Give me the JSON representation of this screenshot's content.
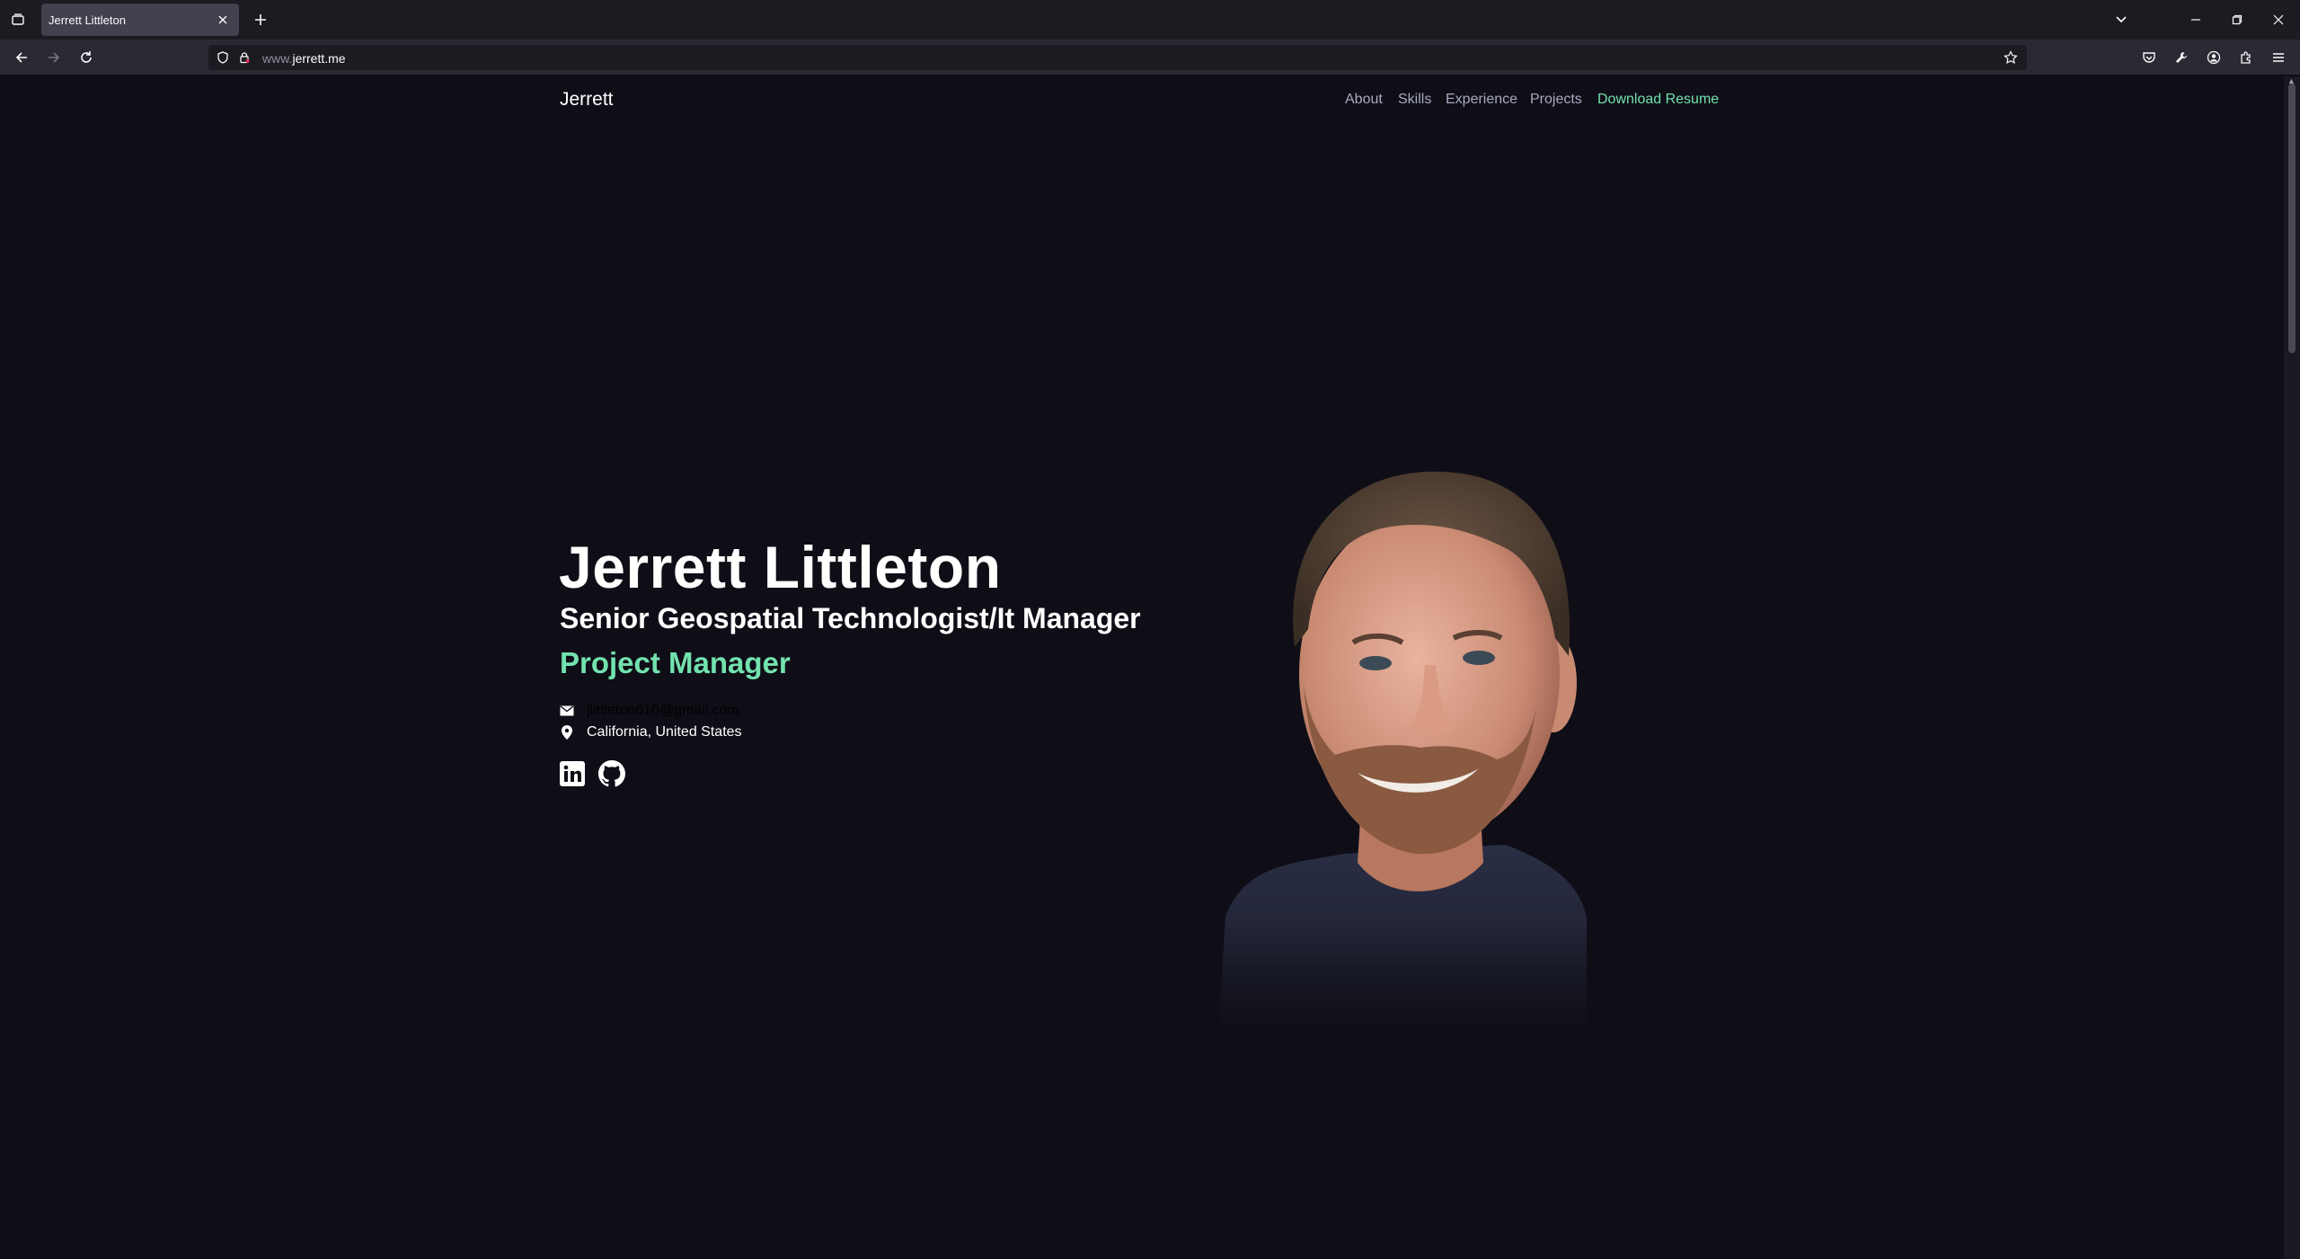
{
  "browser": {
    "tab_title": "Jerrett Littleton",
    "url_prefix": "www.",
    "url_domain": "jerrett.me"
  },
  "site": {
    "brand": "Jerrett",
    "nav": [
      {
        "label": "About"
      },
      {
        "label": "Skills"
      },
      {
        "label": "Experience"
      },
      {
        "label": "Projects"
      },
      {
        "label": "Download Resume"
      }
    ]
  },
  "hero": {
    "name": "Jerrett Littleton",
    "title": "Senior Geospatial Technologist/It Manager",
    "subtitle": "Project Manager",
    "email": "jlittleton610@gmail.com",
    "location": "California, United States"
  },
  "colors": {
    "background": "#0f0e17",
    "text": "#fffffe",
    "muted": "#a7a9be",
    "accent": "#72e2ae"
  },
  "icons": [
    "tab-list-icon",
    "close-icon",
    "plus-icon",
    "chevron-down-icon",
    "minimize-icon",
    "restore-icon",
    "back-icon",
    "forward-icon",
    "reload-icon",
    "shield-icon",
    "lock-icon",
    "star-icon",
    "pocket-icon",
    "wrench-icon",
    "account-icon",
    "extensions-icon",
    "menu-icon",
    "mail-icon",
    "location-pin-icon",
    "linkedin-icon",
    "github-icon"
  ]
}
